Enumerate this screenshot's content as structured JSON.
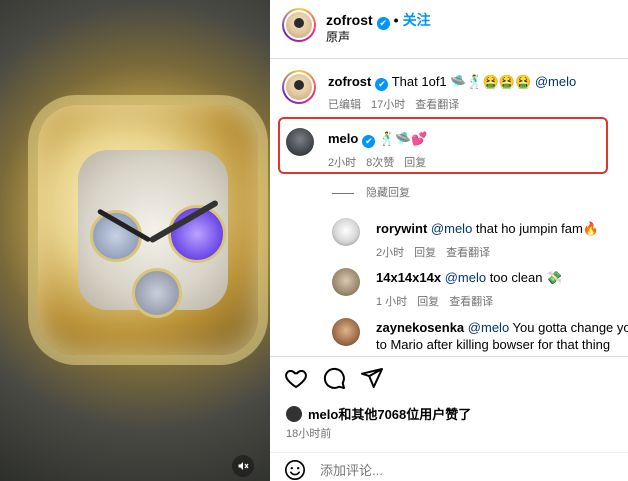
{
  "header": {
    "username": "zofrost",
    "verified_glyph": "✔",
    "separator": "•",
    "follow_label": "关注",
    "subtitle": "原声"
  },
  "caption": {
    "username": "zofrost",
    "text": "That 1of1 🛸🕺🤮🤮🤮",
    "mention": "@melo",
    "meta": {
      "edited": "已编辑",
      "time": "17小时",
      "translate": "查看翻译"
    }
  },
  "comments": [
    {
      "username": "melo",
      "text": "🕺🛸💕",
      "time": "2小时",
      "likes": "8次赞",
      "reply": "回复"
    }
  ],
  "hide_replies": "隐藏回复",
  "replies": [
    {
      "username": "rorywint",
      "mention": "@melo",
      "text": " that ho jumpin fam🔥",
      "time": "2小时",
      "reply": "回复",
      "translate": "查看翻译"
    },
    {
      "username": "14x14x14x",
      "mention": "@melo",
      "text": " too clean 💸",
      "time": "1 小时",
      "reply": "回复",
      "translate": "查看翻译"
    },
    {
      "username": "zaynekosenka",
      "mention": "@melo",
      "text": " You gotta change you",
      "text2": "to Mario after killing bowser for that thing"
    }
  ],
  "actions": {
    "like_icon": "heart-icon",
    "comment_icon": "comment-icon",
    "share_icon": "send-icon"
  },
  "likes_text": "melo和其他7068位用户赞了",
  "post_time": "18小时前",
  "add_comment_placeholder": "添加评论...",
  "media": {
    "mute_icon": "volume-mute-icon"
  }
}
